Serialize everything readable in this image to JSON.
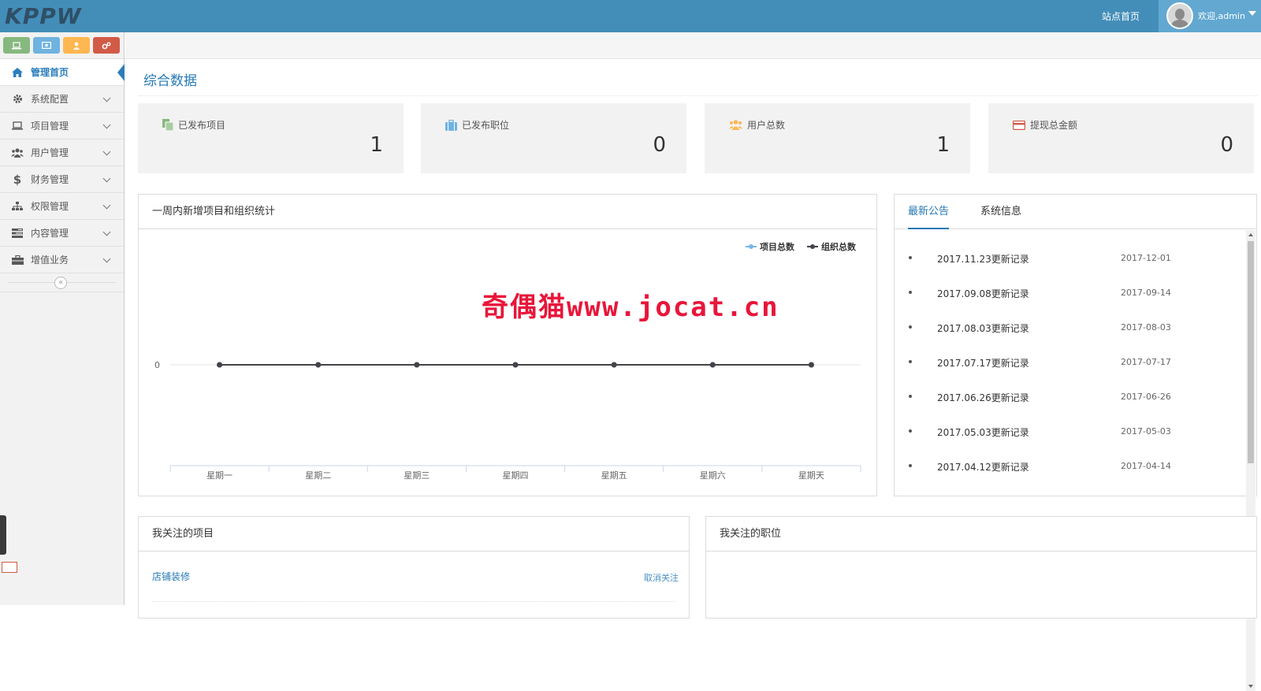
{
  "header": {
    "logo": "KPPW",
    "site_home": "站点首页",
    "welcome": "欢迎,admin"
  },
  "sidebar": {
    "items": [
      {
        "label": "管理首页",
        "icon": "home-icon"
      },
      {
        "label": "系统配置",
        "icon": "cog-icon"
      },
      {
        "label": "项目管理",
        "icon": "laptop-icon"
      },
      {
        "label": "用户管理",
        "icon": "users-icon"
      },
      {
        "label": "财务管理",
        "icon": "dollar-icon"
      },
      {
        "label": "权限管理",
        "icon": "sitemap-icon"
      },
      {
        "label": "内容管理",
        "icon": "tasks-icon"
      },
      {
        "label": "增值业务",
        "icon": "briefcase-icon"
      }
    ],
    "collapse_symbol": "«"
  },
  "page": {
    "title": "综合数据"
  },
  "stats": [
    {
      "label": "已发布项目",
      "value": "1",
      "color": "#87b87f"
    },
    {
      "label": "已发布职位",
      "value": "0",
      "color": "#6fb3e0"
    },
    {
      "label": "用户总数",
      "value": "1",
      "color": "#ffb752"
    },
    {
      "label": "提现总金额",
      "value": "0",
      "color": "#d15b47"
    }
  ],
  "weekly_panel": {
    "title": "一周内新增项目和组织统计"
  },
  "watermark": "奇偶猫www.jocat.cn",
  "chart_data": {
    "type": "line",
    "title": "",
    "categories": [
      "星期一",
      "星期二",
      "星期三",
      "星期四",
      "星期五",
      "星期六",
      "星期天"
    ],
    "series": [
      {
        "name": "项目总数",
        "values": [
          0,
          0,
          0,
          0,
          0,
          0,
          0
        ],
        "color": "#7cb5ec"
      },
      {
        "name": "组织总数",
        "values": [
          0,
          0,
          0,
          0,
          0,
          0,
          0
        ],
        "color": "#434348"
      }
    ],
    "y_ticks": [
      "0"
    ],
    "legend_position": "top-right",
    "grid": true
  },
  "notice_panel": {
    "tabs": [
      "最新公告",
      "系统信息"
    ],
    "items": [
      {
        "title": "2017.11.23更新记录",
        "date": "2017-12-01"
      },
      {
        "title": "2017.09.08更新记录",
        "date": "2017-09-14"
      },
      {
        "title": "2017.08.03更新记录",
        "date": "2017-08-03"
      },
      {
        "title": "2017.07.17更新记录",
        "date": "2017-07-17"
      },
      {
        "title": "2017.06.26更新记录",
        "date": "2017-06-26"
      },
      {
        "title": "2017.05.03更新记录",
        "date": "2017-05-03"
      },
      {
        "title": "2017.04.12更新记录",
        "date": "2017-04-14"
      }
    ]
  },
  "followed_projects": {
    "title": "我关注的项目",
    "items": [
      {
        "name": "店铺装修",
        "action": "取消关注"
      }
    ]
  },
  "followed_jobs": {
    "title": "我关注的职位"
  }
}
